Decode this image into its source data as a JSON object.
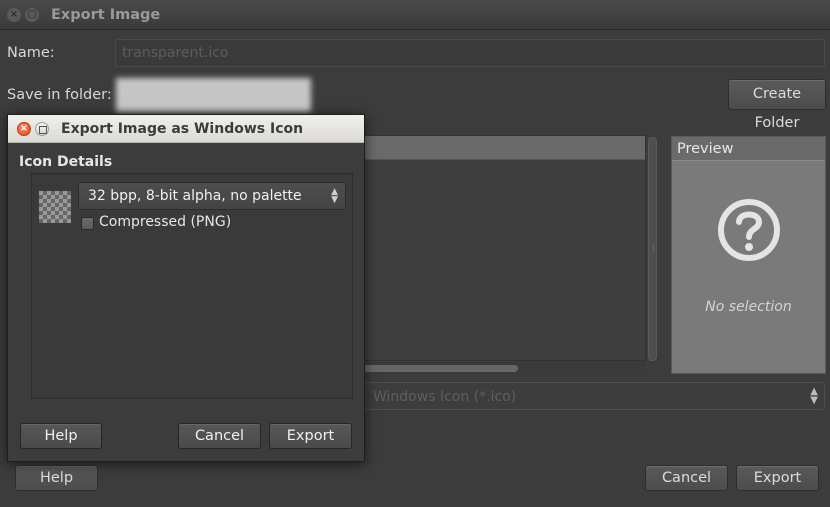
{
  "background_window": {
    "title": "Export Image",
    "name_label": "Name:",
    "name_value": "transparent.ico",
    "save_in_folder_label": "Save in folder:",
    "create_folder_label": "Create Folder",
    "preview_title": "Preview",
    "preview_empty": "No selection",
    "file_type_value": "Windows Icon (*.ico)",
    "help_label": "Help",
    "cancel_label": "Cancel",
    "export_label": "Export"
  },
  "dialog": {
    "title": "Export Image as Windows Icon",
    "section_title": "Icon Details",
    "format_selected": "32 bpp, 8-bit alpha, no palette",
    "compressed_label": "Compressed (PNG)",
    "compressed_checked": false,
    "help_label": "Help",
    "cancel_label": "Cancel",
    "export_label": "Export"
  }
}
